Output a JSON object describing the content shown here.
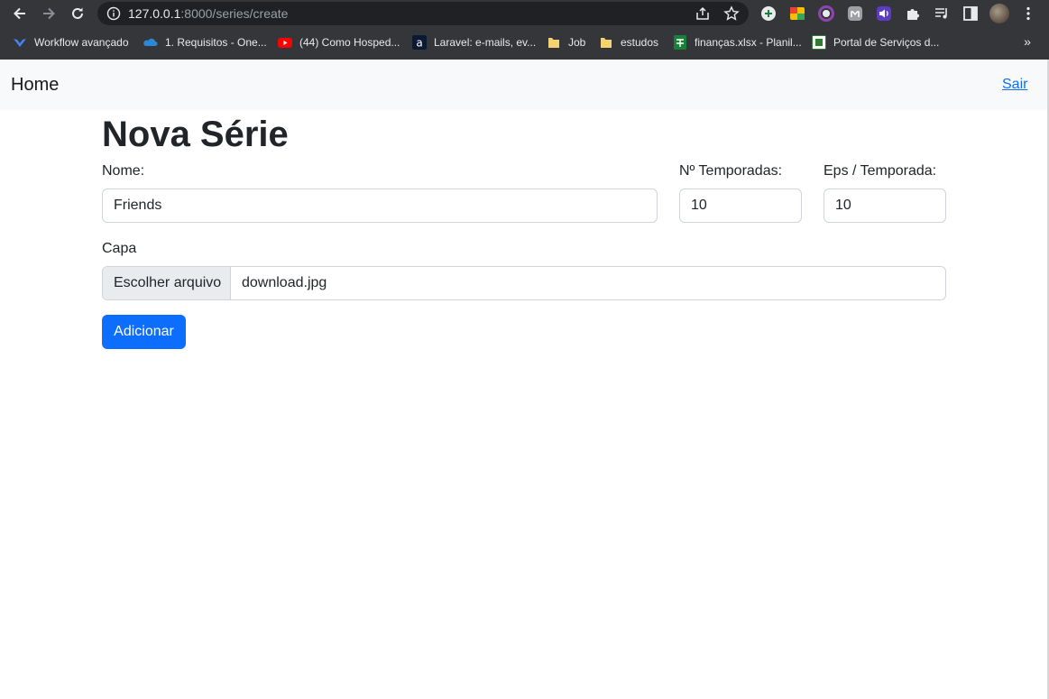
{
  "browser": {
    "url_host": "127.0.0.1",
    "url_path": ":8000/series/create",
    "bookmarks": [
      {
        "label": "Workflow avançado",
        "icon": "workflow-icon",
        "color": "#4285f4"
      },
      {
        "label": "1. Requisitos - One...",
        "icon": "onedrive-icon",
        "color": "#2b88d8"
      },
      {
        "label": "(44) Como Hosped...",
        "icon": "youtube-icon",
        "color": "#ff0000"
      },
      {
        "label": "Laravel: e-mails, ev...",
        "icon": "alura-icon",
        "color": "#0b1a33"
      },
      {
        "label": "Job",
        "icon": "folder-icon",
        "color": "#f5d372"
      },
      {
        "label": "estudos",
        "icon": "folder-icon",
        "color": "#f5d372"
      },
      {
        "label": "finanças.xlsx - Planil...",
        "icon": "sheets-icon",
        "color": "#188038"
      },
      {
        "label": "Portal de Serviços d...",
        "icon": "portal-icon",
        "color": "#2e7d32"
      }
    ],
    "more_label": "»"
  },
  "navbar": {
    "brand": "Home",
    "logout": "Sair"
  },
  "page": {
    "title": "Nova Série"
  },
  "form": {
    "name": {
      "label": "Nome:",
      "value": "Friends"
    },
    "seasons": {
      "label": "Nº Temporadas:",
      "value": "10"
    },
    "episodes": {
      "label": "Eps / Temporada:",
      "value": "10"
    },
    "cover": {
      "label": "Capa",
      "button": "Escolher arquivo",
      "filename": "download.jpg"
    },
    "submit": "Adicionar"
  }
}
